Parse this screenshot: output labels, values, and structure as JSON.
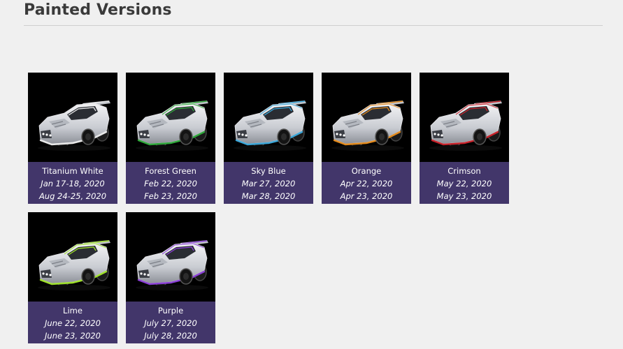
{
  "page": {
    "title": "Painted Versions"
  },
  "colors": {
    "caption_bg": "#42366a",
    "thumb_bg": "#000000",
    "page_bg": "#f0f0f0"
  },
  "items": [
    {
      "name": "Titanium White",
      "date1": "Jan 17-18, 2020",
      "date2": "Aug 24-25, 2020",
      "paint": "#e8e8e8"
    },
    {
      "name": "Forest Green",
      "date1": "Feb 22, 2020",
      "date2": "Feb 23, 2020",
      "paint": "#2fa83a"
    },
    {
      "name": "Sky Blue",
      "date1": "Mar 27, 2020",
      "date2": "Mar 28, 2020",
      "paint": "#3aa6d8"
    },
    {
      "name": "Orange",
      "date1": "Apr 22, 2020",
      "date2": "Apr 23, 2020",
      "paint": "#e38a1c"
    },
    {
      "name": "Crimson",
      "date1": "May 22, 2020",
      "date2": "May 23, 2020",
      "paint": "#c8222a"
    },
    {
      "name": "Lime",
      "date1": "June 22, 2020",
      "date2": "June 23, 2020",
      "paint": "#9ee02a"
    },
    {
      "name": "Purple",
      "date1": "July 27, 2020",
      "date2": "July 28, 2020",
      "paint": "#8a3fd6"
    }
  ]
}
